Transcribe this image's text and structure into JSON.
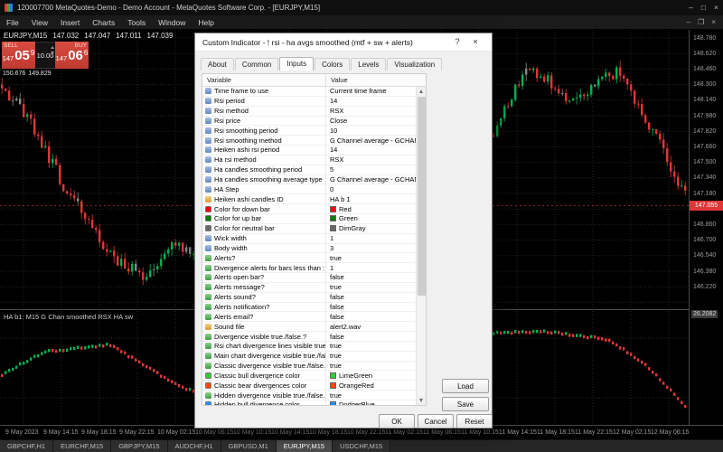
{
  "window": {
    "title": "120007700 MetaQuotes-Demo - Demo Account - MetaQuotes Software Corp. - [EURJPY,M15]",
    "controls": {
      "minimize": "–",
      "maximize": "□",
      "close": "×"
    },
    "child_controls": {
      "minimize": "–",
      "restore": "❐",
      "close": "×"
    }
  },
  "menu": {
    "items": [
      "File",
      "View",
      "Insert",
      "Charts",
      "Tools",
      "Window",
      "Help"
    ]
  },
  "trade": {
    "sell_label": "SELL",
    "sell_prefix": "147",
    "sell_big": "05",
    "sell_sup": "9",
    "buy_label": "BUY",
    "buy_prefix": "147",
    "buy_big": "06",
    "buy_sup": "6",
    "lot": "10.00",
    "high": "150.676",
    "low": "149.829"
  },
  "chart": {
    "symbol": "EURJPY,M15",
    "open": "147.032",
    "high": "147.047",
    "low": "147.011",
    "close": "147.039",
    "price_scale": {
      "labels": [
        "148.780",
        "148.620",
        "148.460",
        "148.300",
        "148.140",
        "147.980",
        "147.820",
        "147.660",
        "147.500",
        "147.340",
        "147.180",
        "147.020",
        "146.860",
        "146.700",
        "146.540",
        "146.380",
        "146.220"
      ],
      "current": "147.055"
    },
    "sub": {
      "label": "HA b1: M15 G Chan smoothed RSX HA sw",
      "value": "26.2082"
    },
    "time_labels": [
      "9 May 2023",
      "9 May 14:15",
      "9 May 18:15",
      "9 May 22:15",
      "10 May 02:15",
      "10 May 06:15",
      "10 May 10:15",
      "10 May 14:15",
      "10 May 18:15",
      "10 May 22:15",
      "11 May 02:15",
      "11 May 06:15",
      "11 May 10:15",
      "11 May 14:15",
      "11 May 18:15",
      "11 May 22:15",
      "12 May 02:15",
      "12 May 06:15"
    ],
    "colors": {
      "up": "#00b050",
      "down": "#e03636",
      "neutral": "#8a8a8a",
      "grid": "#242424",
      "price_line": "#e03636",
      "sub_up": "#00b050",
      "sub_down": "#e03636"
    }
  },
  "dialog": {
    "title": "Custom Indicator - ! rsi - ha avgs smoothed (mtf + sw + alerts)",
    "help_glyph": "?",
    "close_glyph": "×",
    "tabs": [
      "About",
      "Common",
      "Inputs",
      "Colors",
      "Levels",
      "Visualization"
    ],
    "active_tab": "Inputs",
    "columns": [
      "Variable",
      "Value"
    ],
    "rows": [
      {
        "name": "Time frame to use",
        "value": "Current time frame",
        "icon": "blue"
      },
      {
        "name": "Rsi period",
        "value": "14",
        "icon": "blue"
      },
      {
        "name": "Rsi method",
        "value": "RSX",
        "icon": "blue"
      },
      {
        "name": "Rsi price",
        "value": "Close",
        "icon": "blue"
      },
      {
        "name": "Rsi smoothing period",
        "value": "10",
        "icon": "blue"
      },
      {
        "name": "Rsi smoothing method",
        "value": "G Channel average - GCHAN",
        "icon": "blue"
      },
      {
        "name": "Heiken ashi rsi period",
        "value": "14",
        "icon": "blue"
      },
      {
        "name": "Ha rsi method",
        "value": "RSX",
        "icon": "blue"
      },
      {
        "name": "Ha candles smoothing period",
        "value": "5",
        "icon": "blue"
      },
      {
        "name": "Ha candles smoothing average type",
        "value": "G Channel average - GCHAN",
        "icon": "blue"
      },
      {
        "name": "HA Step",
        "value": "0",
        "icon": "blue"
      },
      {
        "name": "Heiken ashi candles ID",
        "value": "HA b 1",
        "icon": "orange"
      },
      {
        "name": "Color for down bar",
        "value": "Red",
        "icon": "swatch",
        "swatch": "#ff0000"
      },
      {
        "name": "Color for up bar",
        "value": "Green",
        "icon": "swatch",
        "swatch": "#008000"
      },
      {
        "name": "Color for neutral bar",
        "value": "DimGray",
        "icon": "swatch",
        "swatch": "#696969"
      },
      {
        "name": "Wick width",
        "value": "1",
        "icon": "blue"
      },
      {
        "name": "Body width",
        "value": "3",
        "icon": "blue"
      },
      {
        "name": "Alerts?",
        "value": "true",
        "icon": "green"
      },
      {
        "name": "Divergence alerts for bars less than :",
        "value": "1",
        "icon": "green"
      },
      {
        "name": "Alerts open bar?",
        "value": "false",
        "icon": "green"
      },
      {
        "name": "Alerts message?",
        "value": "true",
        "icon": "green"
      },
      {
        "name": "Alerts sound?",
        "value": "false",
        "icon": "green"
      },
      {
        "name": "Alerts notification?",
        "value": "false",
        "icon": "green"
      },
      {
        "name": "Alerts email?",
        "value": "false",
        "icon": "green"
      },
      {
        "name": "Sound file",
        "value": "alert2.wav",
        "icon": "orange"
      },
      {
        "name": "Divergence visible true./false.?",
        "value": "false",
        "icon": "green"
      },
      {
        "name": "Rsi chart divergence lines visible true./false.?",
        "value": "true",
        "icon": "green"
      },
      {
        "name": "Main chart divergence visible true./false.?",
        "value": "true",
        "icon": "green"
      },
      {
        "name": "Classic divergence visible true./false.?",
        "value": "true",
        "icon": "green"
      },
      {
        "name": "Classic bull divergence color",
        "value": "LimeGreen",
        "icon": "swatch",
        "swatch": "#32cd32"
      },
      {
        "name": "Classic bear divergences color",
        "value": "OrangeRed",
        "icon": "swatch",
        "swatch": "#ff4500"
      },
      {
        "name": "Hidden divergence visible true./false.?",
        "value": "true",
        "icon": "green"
      },
      {
        "name": "Hidden bull divergence color",
        "value": "DodgerBlue",
        "icon": "swatch",
        "swatch": "#1e90ff"
      }
    ],
    "buttons": {
      "load": "Load",
      "save": "Save",
      "ok": "OK",
      "cancel": "Cancel",
      "reset": "Reset"
    }
  },
  "tabsbar": {
    "items": [
      "GBPCHF,H1",
      "EURCHF,M15",
      "GBPJPY,M15",
      "AUDCHF,H1",
      "GBPUSD,M1",
      "EURJPY,M15",
      "USDCHF,M15"
    ],
    "active": "EURJPY,M15"
  }
}
